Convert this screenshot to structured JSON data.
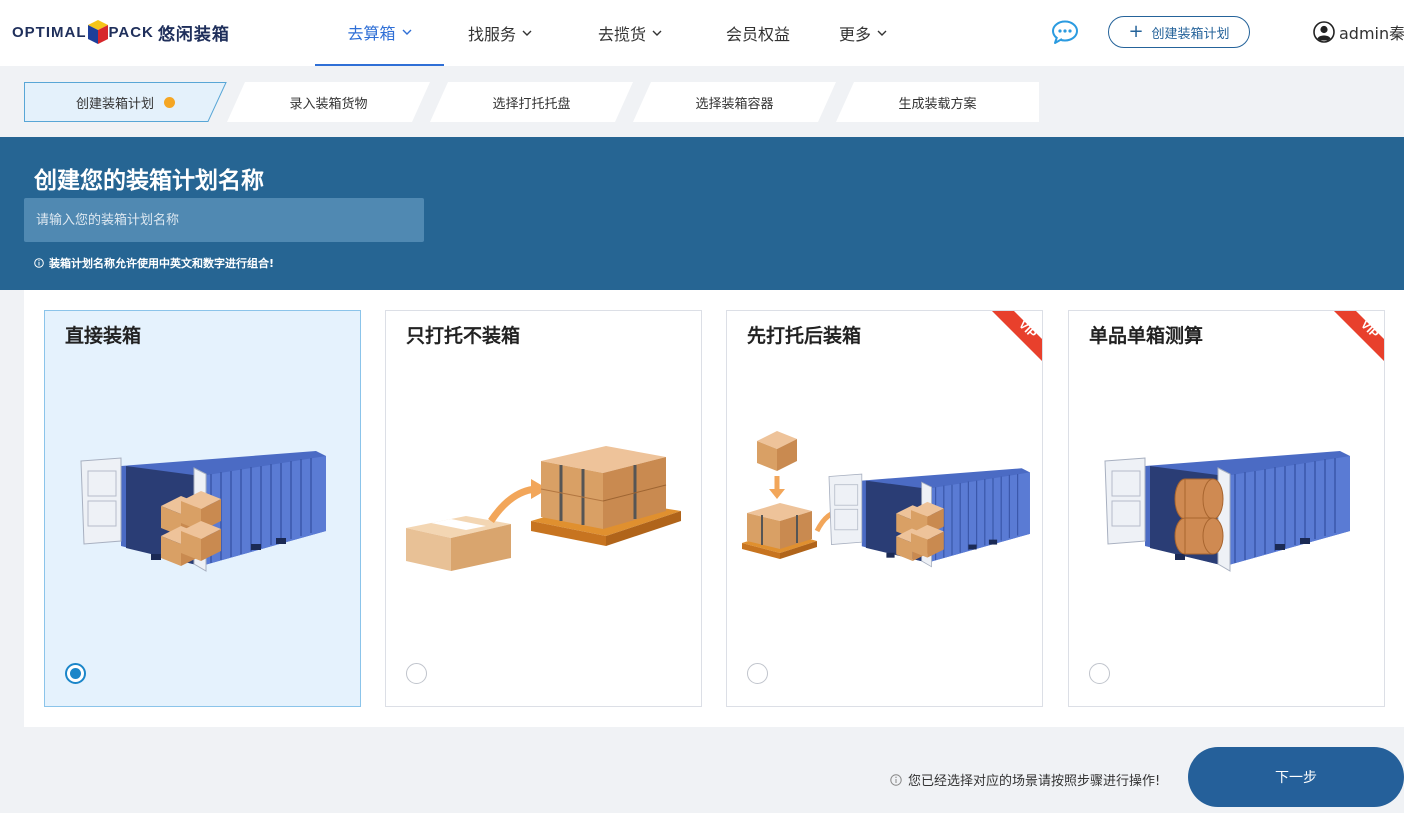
{
  "brand": {
    "logo_part1": "OPTIMAL",
    "logo_part2": "PACK",
    "logo_cn": "悠闲装箱"
  },
  "nav": {
    "items": [
      {
        "label": "去算箱",
        "has_dropdown": true,
        "active": true
      },
      {
        "label": "找服务",
        "has_dropdown": true
      },
      {
        "label": "去揽货",
        "has_dropdown": true
      },
      {
        "label": "会员权益",
        "has_dropdown": false
      },
      {
        "label": "更多",
        "has_dropdown": true
      }
    ],
    "chat_icon": "chat-bubble-icon",
    "create_button": "创建装箱计划",
    "user": "admin秦"
  },
  "steps": [
    {
      "label": "创建装箱计划",
      "active": true
    },
    {
      "label": "录入装箱货物"
    },
    {
      "label": "选择打托托盘"
    },
    {
      "label": "选择装箱容器"
    },
    {
      "label": "生成装载方案"
    }
  ],
  "banner": {
    "title": "创建您的装箱计划名称",
    "input_placeholder": "请输入您的装箱计划名称",
    "input_value": "",
    "hint": "装箱计划名称允许使用中英文和数字进行组合!"
  },
  "cards": [
    {
      "title": "直接装箱",
      "selected": true,
      "vip": false
    },
    {
      "title": "只打托不装箱",
      "selected": false,
      "vip": false
    },
    {
      "title": "先打托后装箱",
      "selected": false,
      "vip": true
    },
    {
      "title": "单品单箱测算",
      "selected": false,
      "vip": true
    }
  ],
  "vip_badge": "VIP",
  "footer": {
    "hint": "您已经选择对应的场景请按照步骤进行操作!",
    "next_button": "下一步"
  },
  "colors": {
    "primary": "#266593",
    "accent": "#2f6fd6",
    "step_dot": "#f5a623",
    "vip": "#e8402c",
    "container": "#4b6bc4",
    "box": "#d9a065"
  }
}
